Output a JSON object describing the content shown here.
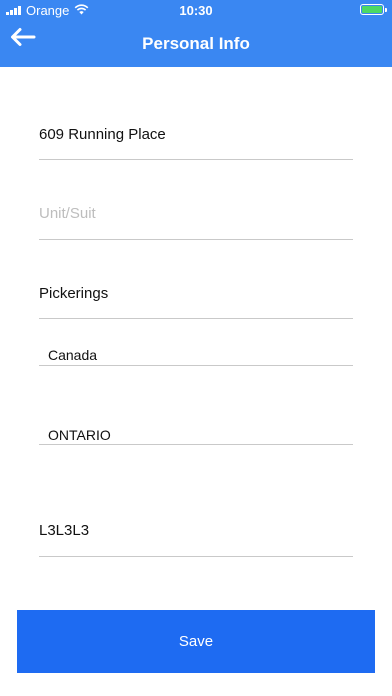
{
  "status_bar": {
    "carrier": "Orange",
    "time": "10:30",
    "wifi_icon": "wifi-icon",
    "battery_icon": "battery-icon",
    "battery_color": "#4CD964"
  },
  "header": {
    "back_icon": "back-arrow-icon",
    "title": "Personal Info",
    "background_color": "#3A87F2"
  },
  "form": {
    "address_value": "609 Running Place",
    "unit_placeholder": "Unit/Suit",
    "unit_value": "",
    "city_value": "Pickerings",
    "country_selected": "Canada",
    "province_selected": "ONTARIO",
    "postal_value": "L3L3L3"
  },
  "save_button": {
    "label": "Save",
    "color": "#1E6BF2"
  }
}
